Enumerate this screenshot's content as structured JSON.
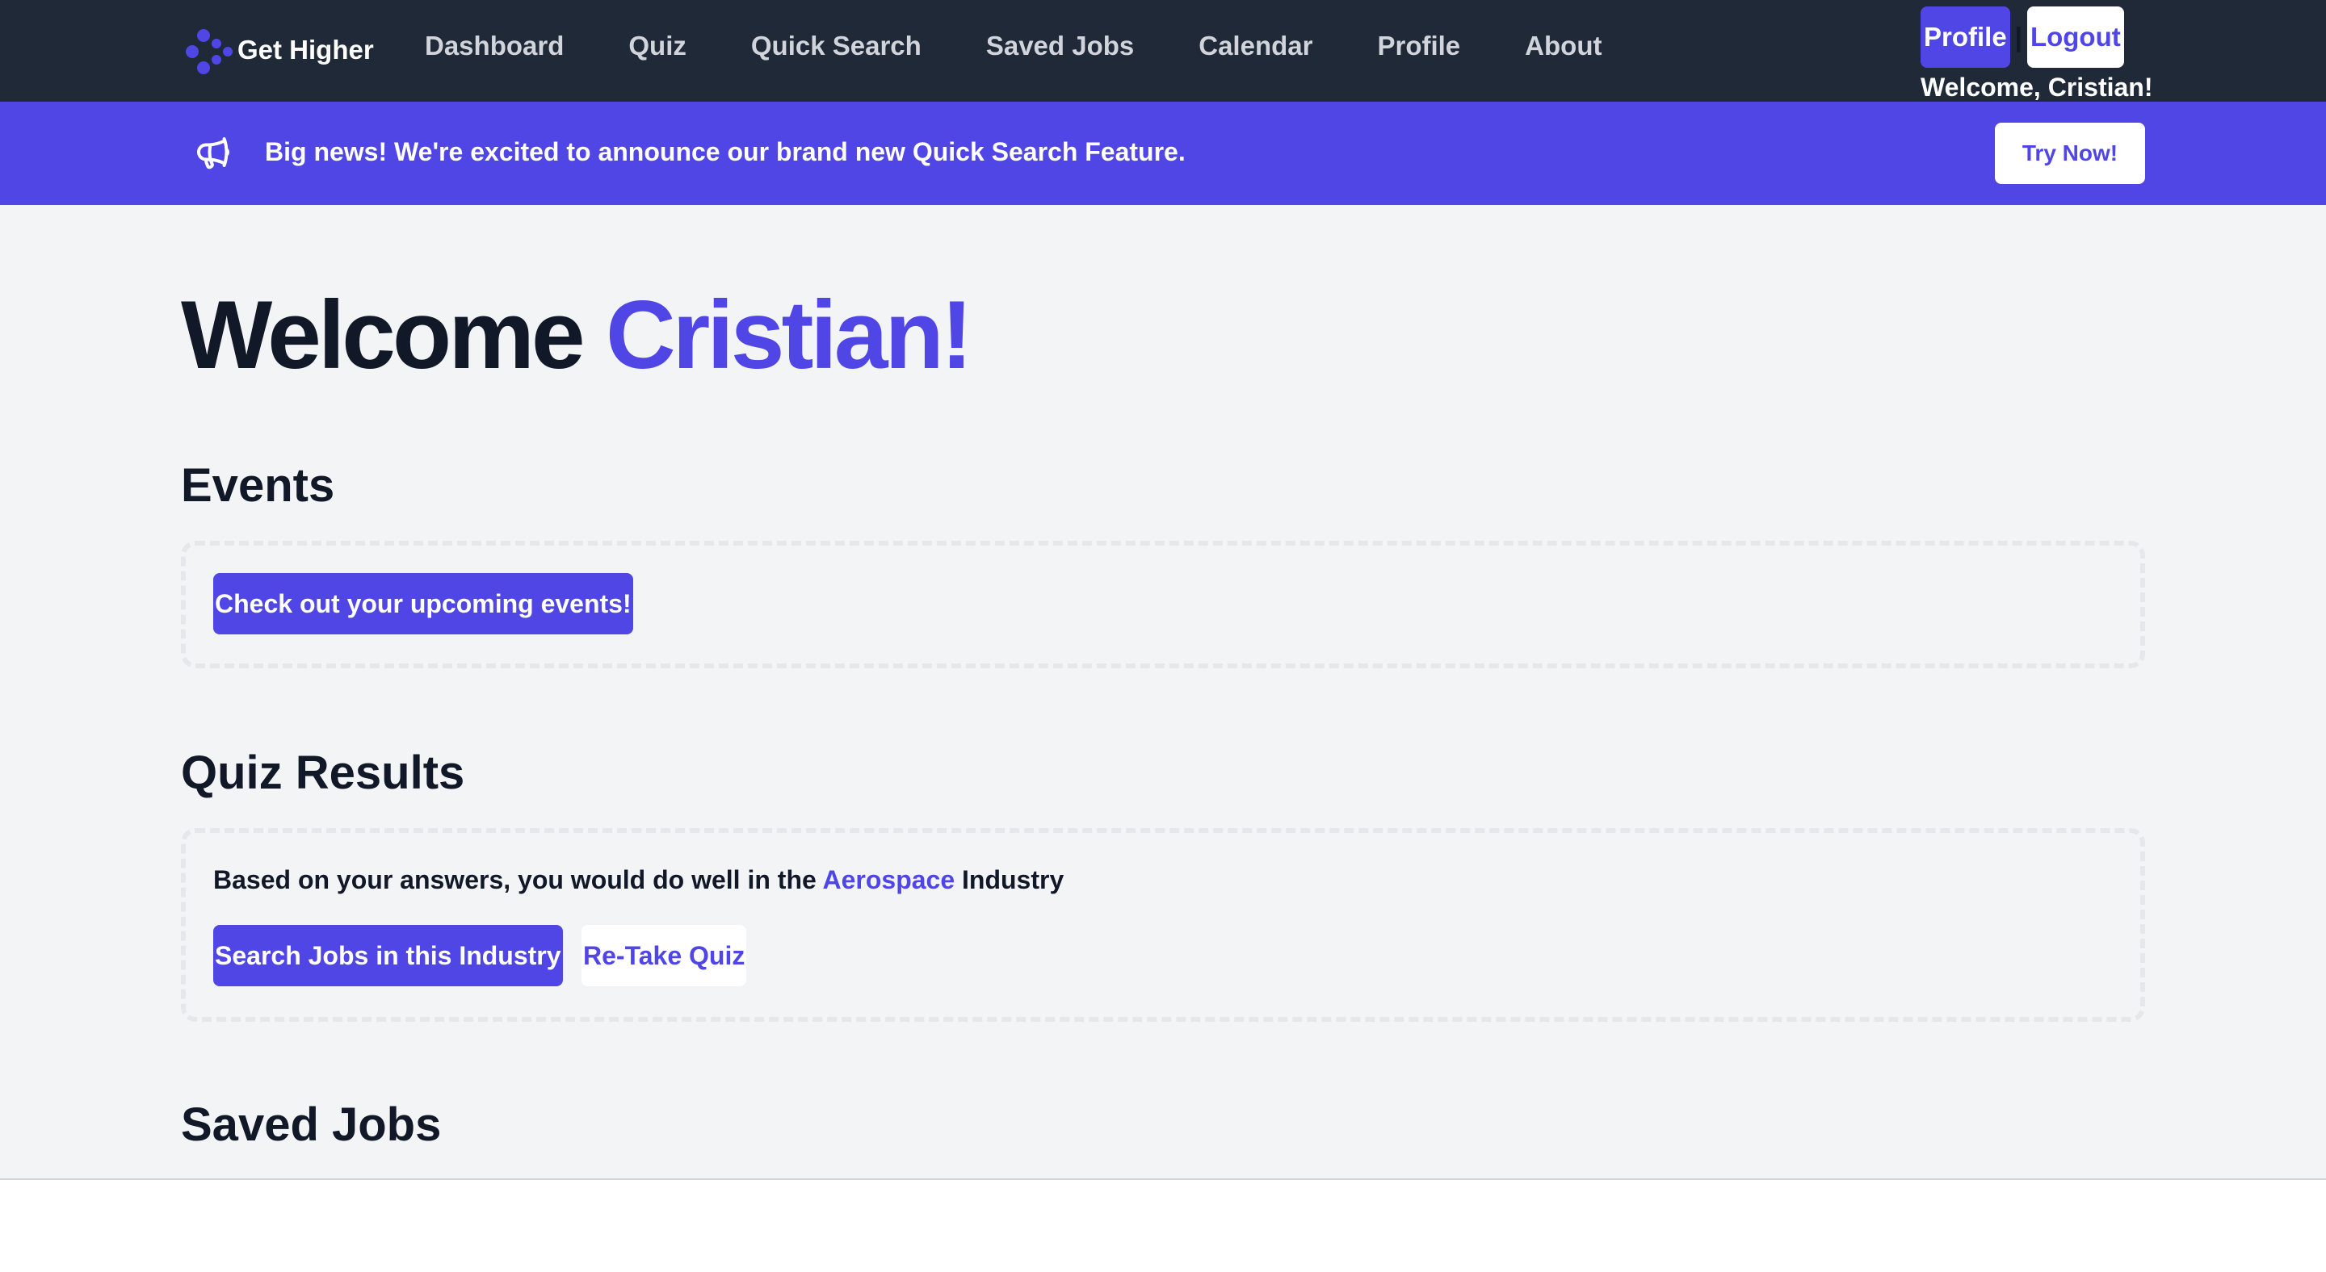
{
  "navbar": {
    "brand_name": "Get Higher",
    "links": [
      "Dashboard",
      "Quiz",
      "Quick Search",
      "Saved Jobs",
      "Calendar",
      "Profile",
      "About"
    ],
    "profile_button": "Profile",
    "separator": "|",
    "logout_button": "Logout",
    "welcome_text": "Welcome, Cristian!"
  },
  "banner": {
    "icon": "megaphone-icon",
    "message": "Big news! We're excited to announce our brand new Quick Search Feature.",
    "button_label": "Try Now!"
  },
  "main": {
    "heading_prefix": "Welcome",
    "heading_name": "Cristian!",
    "events": {
      "title": "Events",
      "button_label": "Check out your upcoming events!"
    },
    "quiz_results": {
      "title": "Quiz Results",
      "text_before": "Based on your answers, you would do well in the ",
      "industry": "Aerospace",
      "text_after": " Industry",
      "search_button": "Search Jobs in this Industry",
      "retake_button": "Re-Take Quiz"
    },
    "saved_jobs": {
      "title": "Saved Jobs"
    }
  },
  "colors": {
    "accent": "#4f46e5",
    "navbar_bg": "#1f2937",
    "page_bg": "#f3f4f6"
  }
}
